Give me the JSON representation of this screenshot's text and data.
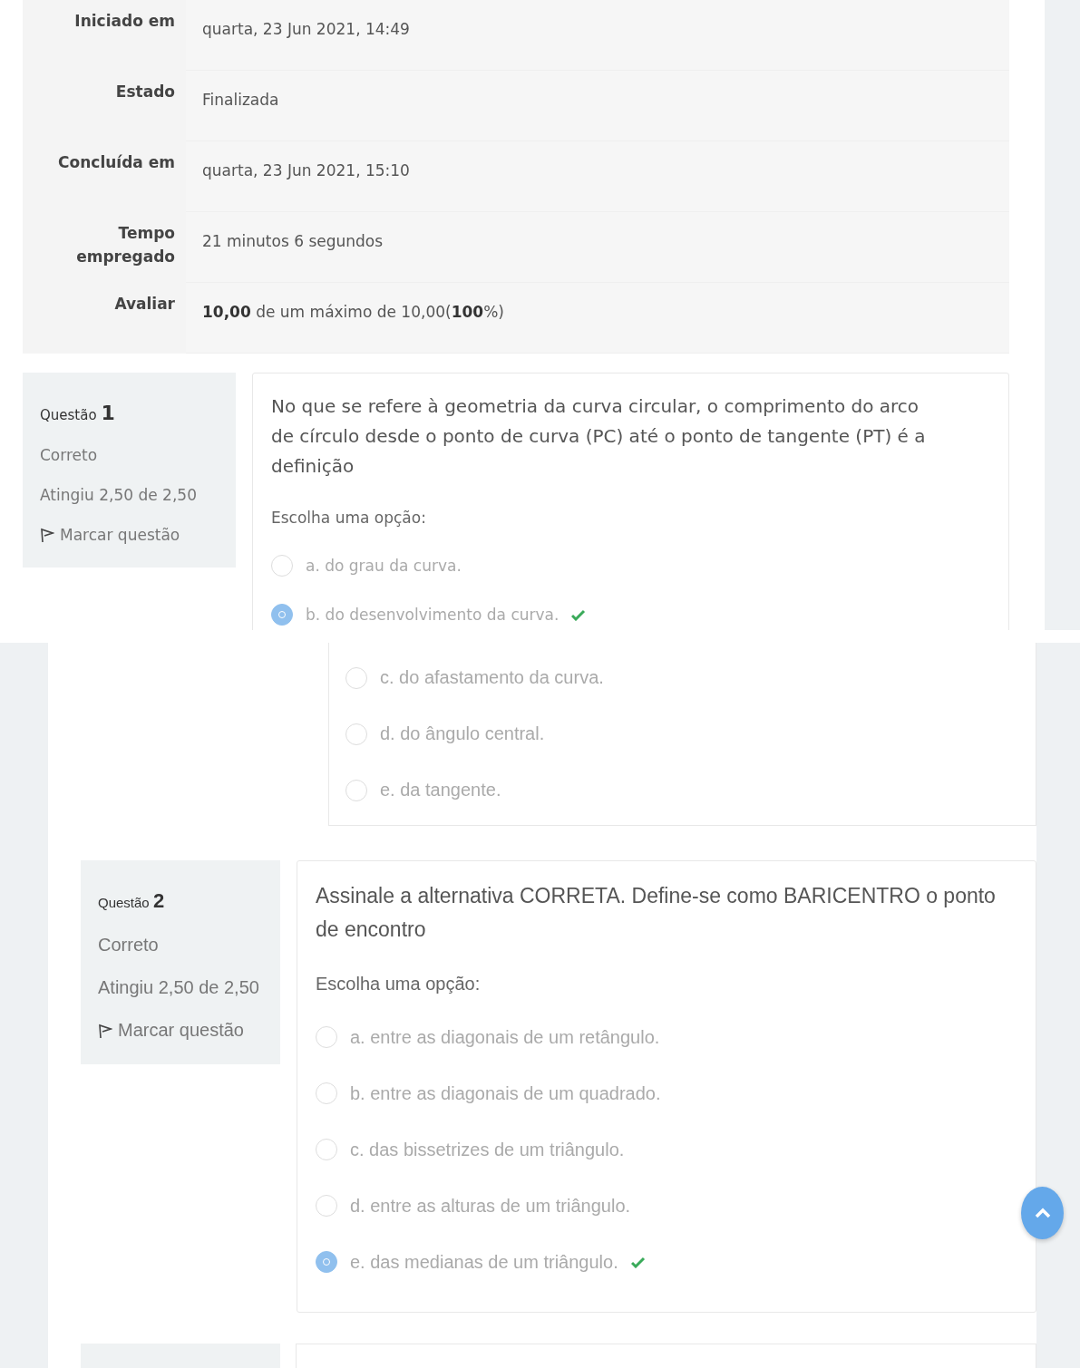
{
  "screenshots": [
    {
      "summary": [
        {
          "label": "Iniciado em",
          "value": "quarta, 23 Jun 2021, 14:49"
        },
        {
          "label": "Estado",
          "value": "Finalizada"
        },
        {
          "label": "Concluída em",
          "value": "quarta, 23 Jun 2021, 15:10"
        },
        {
          "label": "Tempo empregado",
          "value": "21 minutos 6 segundos"
        },
        {
          "label": "Avaliar",
          "value": "**10,00** de um máximo de 10,00(**100**%)"
        }
      ],
      "questions": [
        {
          "word": "Questão",
          "number": "1",
          "status": "Correto",
          "grade": "Atingiu 2,50 de 2,50",
          "flag_label": "Marcar questão",
          "text": "No que se refere à geometria da curva circular, o comprimento do arco de círculo desde o ponto de curva (PC) até o ponto de tangente (PT) é a definição",
          "prompt": "Escolha uma opção:",
          "options": [
            {
              "label": "a. do grau da curva.",
              "selected": false,
              "correct": false
            },
            {
              "label": "b. do desenvolvimento da curva.",
              "selected": true,
              "correct": true
            }
          ]
        }
      ]
    },
    {
      "continued_options": [
        {
          "label": "c. do afastamento da curva.",
          "selected": false,
          "correct": false
        },
        {
          "label": "d. do ângulo central.",
          "selected": false,
          "correct": false
        },
        {
          "label": "e. da tangente.",
          "selected": false,
          "correct": false
        }
      ],
      "questions": [
        {
          "word": "Questão",
          "number": "2",
          "status": "Correto",
          "grade": "Atingiu 2,50 de 2,50",
          "flag_label": "Marcar questão",
          "text": "Assinale a alternativa CORRETA. Define-se como BARICENTRO o ponto de encontro",
          "prompt": "Escolha uma opção:",
          "options": [
            {
              "label": "a. entre as diagonais de um retângulo.",
              "selected": false,
              "correct": false
            },
            {
              "label": "b. entre as diagonais de um quadrado.",
              "selected": false,
              "correct": false
            },
            {
              "label": "c. das bissetrizes de um triângulo.",
              "selected": false,
              "correct": false
            },
            {
              "label": "d. entre as alturas de um triângulo.",
              "selected": false,
              "correct": false
            },
            {
              "label": "e. das medianas de um triângulo.",
              "selected": true,
              "correct": true
            }
          ]
        }
      ]
    }
  ]
}
